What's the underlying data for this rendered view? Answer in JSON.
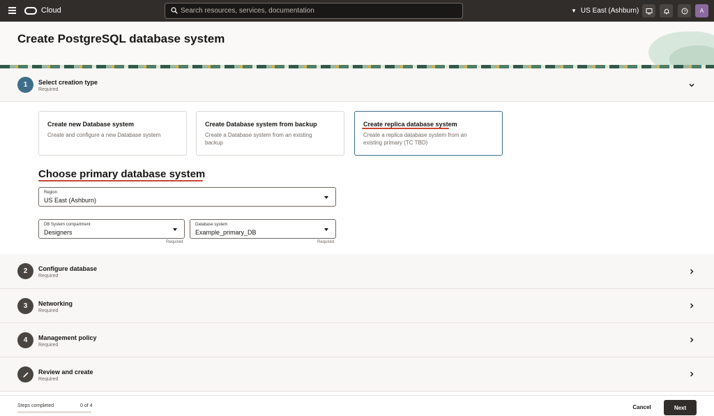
{
  "topbar": {
    "brand": "Cloud",
    "search_placeholder": "Search resources, services, documentation",
    "region": "US East (Ashburn)",
    "avatar_initial": "A"
  },
  "page": {
    "title": "Create PostgreSQL database system"
  },
  "steps": [
    {
      "number": "1",
      "title": "Select creation type",
      "subtitle": "Required",
      "state": "expanded"
    },
    {
      "number": "2",
      "title": "Configure database",
      "subtitle": "Required",
      "state": "collapsed"
    },
    {
      "number": "3",
      "title": "Networking",
      "subtitle": "Required",
      "state": "collapsed"
    },
    {
      "number": "4",
      "title": "Management policy",
      "subtitle": "Required",
      "state": "collapsed"
    },
    {
      "number": "",
      "icon": "pencil-icon",
      "title": "Review and create",
      "subtitle": "Required",
      "state": "collapsed"
    }
  ],
  "creation_options": [
    {
      "title": "Create new Database system",
      "description": "Create and configure a new Database system",
      "selected": false
    },
    {
      "title": "Create Database system from backup",
      "description": "Create a Database system from an existing backup",
      "selected": false
    },
    {
      "title": "Create replica database system",
      "description": "Create a replica database system from an existing primary (TC TBD)",
      "selected": true
    }
  ],
  "primary_section": {
    "heading": "Choose primary database system",
    "region_field": {
      "label": "Region",
      "value": "US East (Ashburn)"
    },
    "compartment_field": {
      "label": "DB System compartment",
      "value": "Designers",
      "helper": "Required"
    },
    "db_system_field": {
      "label": "Database system",
      "value": "Example_primary_DB",
      "helper": "Required"
    }
  },
  "footer": {
    "steps_label": "Steps completed",
    "steps_count": "0 of 4",
    "progress_fraction": 0.0,
    "cancel_label": "Cancel",
    "next_label": "Next"
  },
  "colors": {
    "topbar": "#312d2a",
    "accent": "#3f6e8a",
    "annotation_red": "#c74634",
    "step_pending": "#4a4541"
  }
}
